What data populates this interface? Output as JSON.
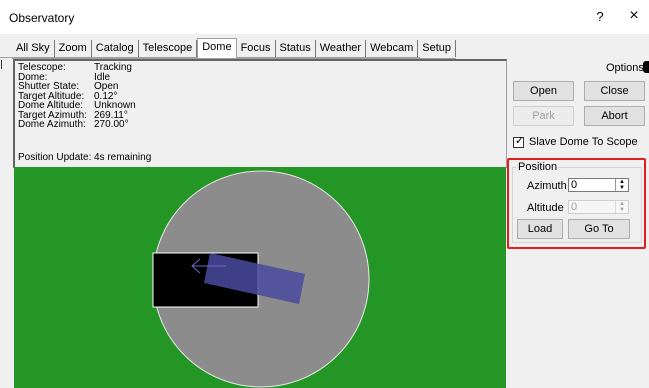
{
  "window": {
    "title": "Observatory",
    "help_label": "?",
    "close_label": "×"
  },
  "tabs": [
    "All Sky",
    "Zoom",
    "Catalog",
    "Telescope",
    "Dome",
    "Focus",
    "Status",
    "Weather",
    "Webcam",
    "Setup"
  ],
  "active_tab": "Dome",
  "info": {
    "rows": [
      {
        "label": "Telescope:",
        "value": "Tracking"
      },
      {
        "label": "Dome:",
        "value": "Idle"
      },
      {
        "label": "Shutter State:",
        "value": "Open"
      },
      {
        "label": "Target Altitude:",
        "value": "0.12°"
      },
      {
        "label": "Dome Altitude:",
        "value": "Unknown"
      },
      {
        "label": "Target Azimuth:",
        "value": "269.11°"
      },
      {
        "label": "Dome Azimuth:",
        "value": "270.00°"
      }
    ],
    "position_update_label": "Position Update:",
    "position_update_value": "4s remaining"
  },
  "controls": {
    "options_label": "Options",
    "open_label": "Open",
    "close_label": "Close",
    "park_label": "Park",
    "abort_label": "Abort",
    "slave_label": "Slave Dome To Scope",
    "slave_checked": true
  },
  "position": {
    "group_label": "Position",
    "azimuth_label": "Azimuth",
    "azimuth_value": "0",
    "altitude_label": "Altitude",
    "altitude_value": "0",
    "load_label": "Load",
    "goto_label": "Go To"
  },
  "colors": {
    "sky_background": "#239625",
    "dome": "#8c8c8c",
    "slit": "#5a5aa8",
    "highlight": "#e21d1d"
  }
}
